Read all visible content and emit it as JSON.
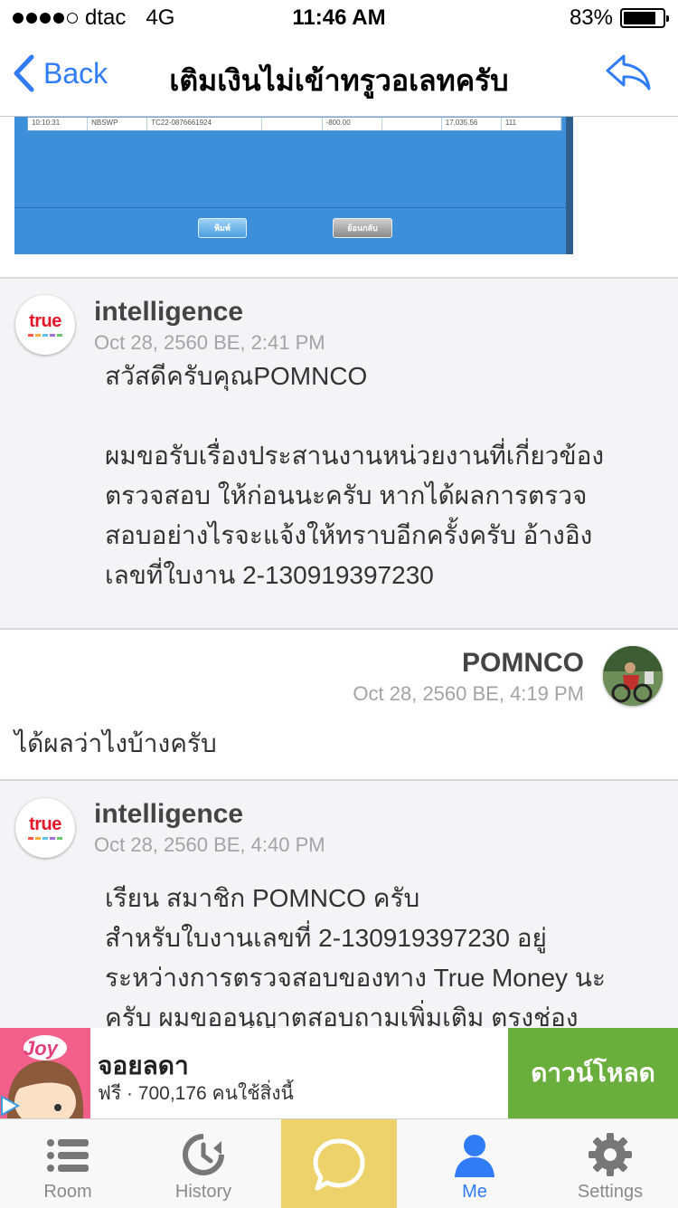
{
  "status_bar": {
    "carrier": "dtac",
    "network": "4G",
    "time": "11:46 AM",
    "battery": "83%",
    "battery_level": 0.83,
    "signal_bars": 4
  },
  "nav": {
    "back_label": "Back",
    "title": "เติมเงินไม่เข้าทรูวอเลทครับ",
    "icons": {
      "back": "chevron-left-icon",
      "reply": "reply-arrow-icon"
    },
    "accent_color": "#2f7cf6"
  },
  "attachment": {
    "row_time": "10:10:31",
    "row_code": "NBSWP",
    "row_ref": "TC22-0876661924",
    "row_amount": "-800.00",
    "row_balance": "17,035.56",
    "row_extra": "111",
    "print_label": "พิมพ์",
    "back_label": "ย้อนกลับ"
  },
  "messages": [
    {
      "author": "intelligence",
      "date": "Oct 28, 2560 BE, 2:41 PM",
      "lines": [
        "สวัสดีครับคุณPOMNCO",
        "",
        "ผมขอรับเรื่องประสานงานหน่วยงานที่เกี่ยวข้อง",
        "ตรวจสอบ ให้ก่อนนะครับ หากได้ผลการตรวจ",
        "สอบอย่างไรจะแจ้งให้ทราบอีกครั้งครับ อ้างอิง",
        "เลขที่ใบงาน 2-130919397230"
      ],
      "avatar_text": "true"
    },
    {
      "author": "POMNCO",
      "date": "Oct 28, 2560 BE, 4:19 PM",
      "lines": [
        "ได้ผลว่าไงบ้างครับ"
      ]
    },
    {
      "author": "intelligence",
      "date": "Oct 28, 2560 BE, 4:40 PM",
      "lines": [
        "เรียน สมาชิก POMNCO ครับ",
        "สำหรับใบงานเลขที่ 2-130919397230 อยู่",
        "ระหว่างการตรวจสอบของทาง True Money นะ",
        "ครับ  ผมขออนุญาตสอบถามเพิ่มเติม ตรงช่อง"
      ],
      "avatar_text": "true"
    }
  ],
  "ad": {
    "icon_text": "Joy",
    "app_name": "จอยลดา",
    "subtitle": "ฟรี · 700,176 คนใช้สิ่งนี้",
    "download_label": "ดาวน์โหลด",
    "download_color": "#6aaf3d"
  },
  "tabs": [
    {
      "label": "Room",
      "icon": "list-icon"
    },
    {
      "label": "History",
      "icon": "history-clock-icon"
    },
    {
      "label": "",
      "icon": "chat-bubble-icon"
    },
    {
      "label": "Me",
      "icon": "person-icon"
    },
    {
      "label": "Settings",
      "icon": "gear-icon"
    }
  ]
}
